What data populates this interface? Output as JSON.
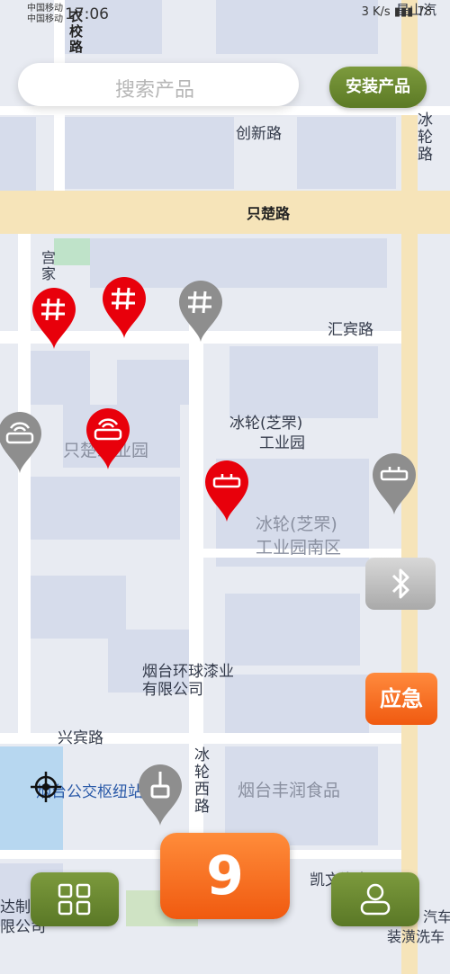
{
  "status_bar": {
    "carrier1": "中国移动",
    "carrier2": "中国移动",
    "time": "17:06",
    "speed": "3 K/s",
    "battery": "78"
  },
  "search": {
    "placeholder": "搜索产品"
  },
  "install_button": {
    "label": "安装产品"
  },
  "map": {
    "labels": {
      "top_road": "衣校路",
      "top_right": "星山汽",
      "chuangxin": "创新路",
      "binglun_top": "冰轮路",
      "zhichu": "只楚路",
      "gongjia": "宫家",
      "huibin": "汇宾路",
      "binglun_poi": "冰轮(芝罘)",
      "binglun_poi2": "工业园",
      "zhichu_park": "只楚工业园",
      "binglun_south1": "冰轮(芝罘)",
      "binglun_south2": "工业园南区",
      "huanqiu1": "烟台环球漆业",
      "huanqiu2": "有限公司",
      "xingbin": "兴宾路",
      "bus_hub": "烟台公交枢纽站",
      "binglun_west": "冰轮西路",
      "fengrun": "烟台丰润食品",
      "kaiwen": "凯文汽车",
      "dazhi1": "达制",
      "dazhi2": "限公司",
      "wash1": "汽车",
      "wash2": "装潢洗车"
    }
  },
  "pins": [
    {
      "name": "grid-pin",
      "color": "#e8000b",
      "icon": "grid"
    },
    {
      "name": "grid-pin",
      "color": "#e8000b",
      "icon": "grid"
    },
    {
      "name": "grid-pin",
      "color": "#8e8e8e",
      "icon": "grid"
    },
    {
      "name": "router-pin",
      "color": "#8e8e8e",
      "icon": "router"
    },
    {
      "name": "router-pin",
      "color": "#e8000b",
      "icon": "router"
    },
    {
      "name": "device-pin",
      "color": "#e8000b",
      "icon": "device"
    },
    {
      "name": "device-pin",
      "color": "#8e8e8e",
      "icon": "device"
    },
    {
      "name": "plug-pin",
      "color": "#8e8e8e",
      "icon": "plug"
    }
  ],
  "bluetooth_button": {
    "icon": "bluetooth-icon"
  },
  "emergency_button": {
    "label": "应急"
  },
  "count_button": {
    "value": "9"
  },
  "menu_button": {
    "icon": "grid-menu-icon"
  },
  "profile_button": {
    "icon": "user-icon"
  },
  "colors": {
    "accent_green": "#6b8a30",
    "accent_orange": "#f26b1d",
    "pin_red": "#e8000b",
    "pin_gray": "#8e8e8e"
  }
}
